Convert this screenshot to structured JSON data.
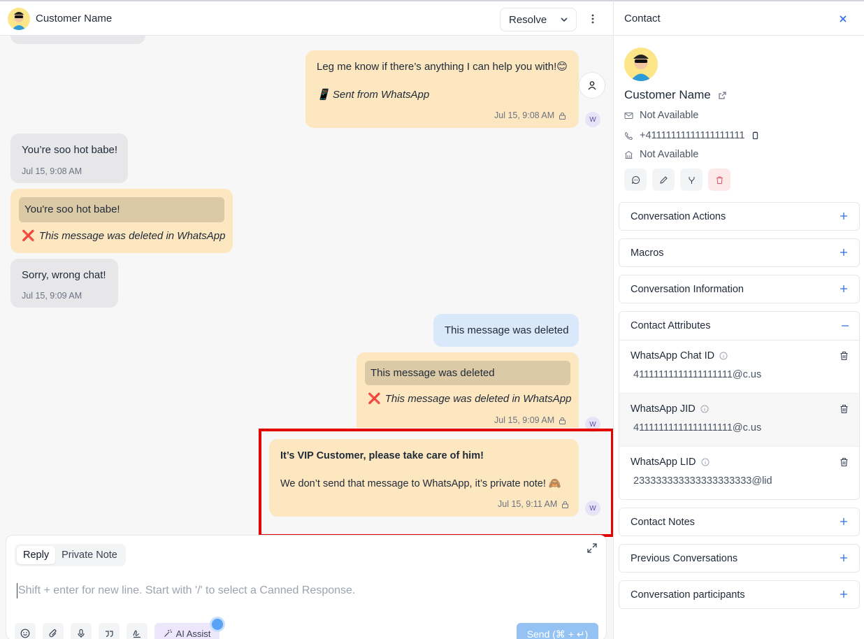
{
  "header": {
    "customer_name": "Customer Name",
    "resolve_label": "Resolve"
  },
  "messages": {
    "m1": {
      "text": "Leg me know if there’s anything I can help you with!😊",
      "source": "📱 Sent from WhatsApp",
      "time": "Jul 15, 9:08 AM"
    },
    "m2": {
      "text": "You’re soo hot babe!",
      "time": "Jul 15, 9:08 AM"
    },
    "m3": {
      "quote": "You're soo hot babe!",
      "deleted": "This message was deleted in WhatsApp"
    },
    "m4": {
      "text": "Sorry, wrong chat!",
      "time": "Jul 15, 9:09 AM"
    },
    "m5": {
      "text": "This message was deleted"
    },
    "m6": {
      "quote": "This message was deleted",
      "deleted": "This message was deleted in WhatsApp",
      "time": "Jul 15, 9:09 AM"
    },
    "m7": {
      "title": "It’s VIP Customer, please take care of him!",
      "text": "We don’t send that message to WhatsApp, it’s private note! 🙈",
      "time": "Jul 15, 9:11 AM"
    },
    "agent_initial": "W",
    "deleted_icon": "❌"
  },
  "composer": {
    "tab_reply": "Reply",
    "tab_private": "Private Note",
    "placeholder": "Shift + enter for new line. Start with '/' to select a Canned Response.",
    "ai_label": "AI Assist",
    "send_label": "Send (⌘ + ↵)"
  },
  "panel": {
    "title": "Contact",
    "name": "Customer Name",
    "email": "Not Available",
    "phone": "+41111111111111111111",
    "company": "Not Available",
    "sections": {
      "actions": "Conversation Actions",
      "macros": "Macros",
      "info": "Conversation Information",
      "attributes": "Contact Attributes",
      "notes": "Contact Notes",
      "previous": "Previous Conversations",
      "participants": "Conversation participants"
    },
    "attributes": [
      {
        "name": "WhatsApp Chat ID",
        "value": "41111111111111111111@c.us"
      },
      {
        "name": "WhatsApp JID",
        "value": "41111111111111111111@c.us"
      },
      {
        "name": "WhatsApp LID",
        "value": "233333333333333333333@lid"
      }
    ]
  },
  "colors": {
    "accent": "#2f6fe0",
    "outgoing": "#fde7c0",
    "incoming": "#e7e7ea",
    "highlight": "#e30000"
  }
}
